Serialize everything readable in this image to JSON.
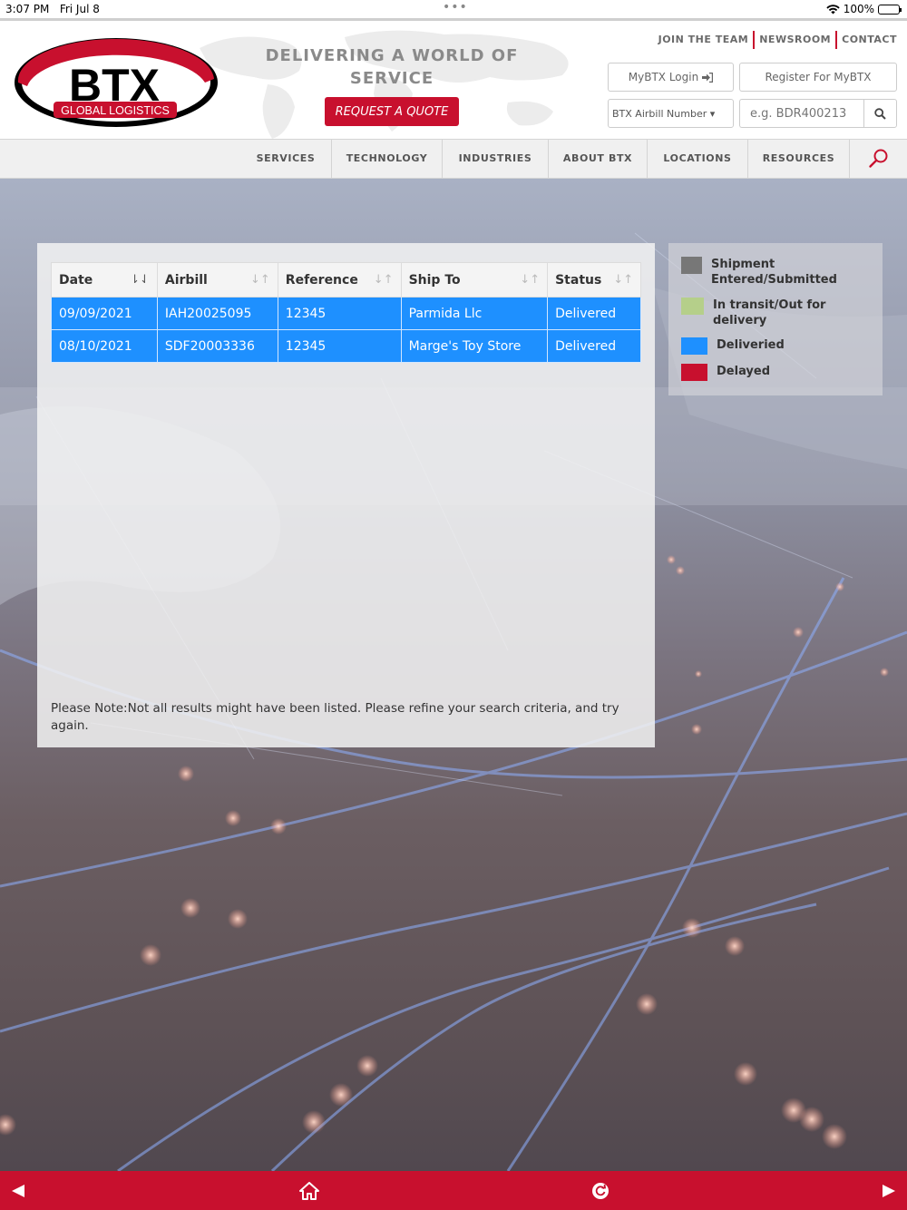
{
  "status_bar": {
    "time": "3:07 PM",
    "date": "Fri Jul 8",
    "battery": "100%"
  },
  "header": {
    "logo_text": "BTX",
    "logo_subtext": "GLOBAL LOGISTICS",
    "tagline_line1": "DELIVERING A WORLD OF",
    "tagline_line2": "SERVICE",
    "quote_button": "REQUEST A QUOTE",
    "links": [
      "JOIN THE TEAM",
      "NEWSROOM",
      "CONTACT"
    ],
    "login_button": "MyBTX Login",
    "register_button": "Register For MyBTX",
    "search_type": "BTX Airbill Number",
    "search_placeholder": "e.g. BDR400213"
  },
  "nav": [
    "SERVICES",
    "TECHNOLOGY",
    "INDUSTRIES",
    "ABOUT BTX",
    "LOCATIONS",
    "RESOURCES"
  ],
  "table": {
    "columns": [
      "Date",
      "Airbill",
      "Reference",
      "Ship To",
      "Status"
    ],
    "rows": [
      [
        "09/09/2021",
        "IAH20025095",
        "12345",
        "Parmida Llc",
        "Delivered"
      ],
      [
        "08/10/2021",
        "SDF20003336",
        "12345",
        "Marge's Toy Store",
        "Delivered"
      ]
    ],
    "note": "Please Note:Not all results might have been listed. Please refine your search criteria, and try again."
  },
  "legend": [
    {
      "label": "Shipment Entered/Submitted",
      "color": "#777777"
    },
    {
      "label": "In transit/Out for delivery",
      "color": "#b5cf8a"
    },
    {
      "label": "Deliveried",
      "color": "#1e90ff"
    },
    {
      "label": "Delayed",
      "color": "#c8102e"
    }
  ],
  "colors": {
    "brand_red": "#c8102e",
    "delivered_blue": "#1e90ff"
  },
  "toolbar": {
    "icons": [
      "back-arrow-icon",
      "home-icon",
      "refresh-icon",
      "forward-arrow-icon"
    ]
  }
}
